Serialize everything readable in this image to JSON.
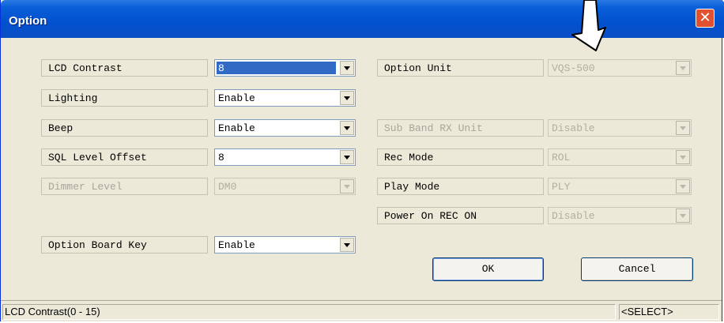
{
  "window": {
    "title": "Option",
    "close_glyph": "✕"
  },
  "left_fields": [
    {
      "label": "LCD Contrast",
      "value": "8",
      "enabled": true,
      "selected": true
    },
    {
      "label": "Lighting",
      "value": "Enable",
      "enabled": true
    },
    {
      "label": "Beep",
      "value": "Enable",
      "enabled": true
    },
    {
      "label": "SQL Level Offset",
      "value": "8",
      "enabled": true
    },
    {
      "label": "Dimmer Level",
      "value": "DM0",
      "enabled": false
    },
    {
      "label": "Option Board Key",
      "value": "Enable",
      "enabled": true
    }
  ],
  "right_fields": [
    {
      "label": "Option Unit",
      "value": "VQS-500",
      "label_enabled": true,
      "enabled": false
    },
    {
      "label": "Sub Band RX Unit",
      "value": "Disable",
      "label_enabled": false,
      "enabled": false
    },
    {
      "label": "Rec Mode",
      "value": "ROL",
      "label_enabled": true,
      "enabled": false
    },
    {
      "label": "Play Mode",
      "value": "PLY",
      "label_enabled": true,
      "enabled": false
    },
    {
      "label": "Power On REC ON",
      "value": "Disable",
      "label_enabled": true,
      "enabled": false
    }
  ],
  "buttons": {
    "ok": "OK",
    "cancel": "Cancel"
  },
  "status": {
    "hint": "LCD Contrast(0 - 15)",
    "mode": "<SELECT>"
  },
  "colors": {
    "titlebar": "#0a5fd8",
    "selection": "#316ac5",
    "face": "#ece9d8"
  }
}
